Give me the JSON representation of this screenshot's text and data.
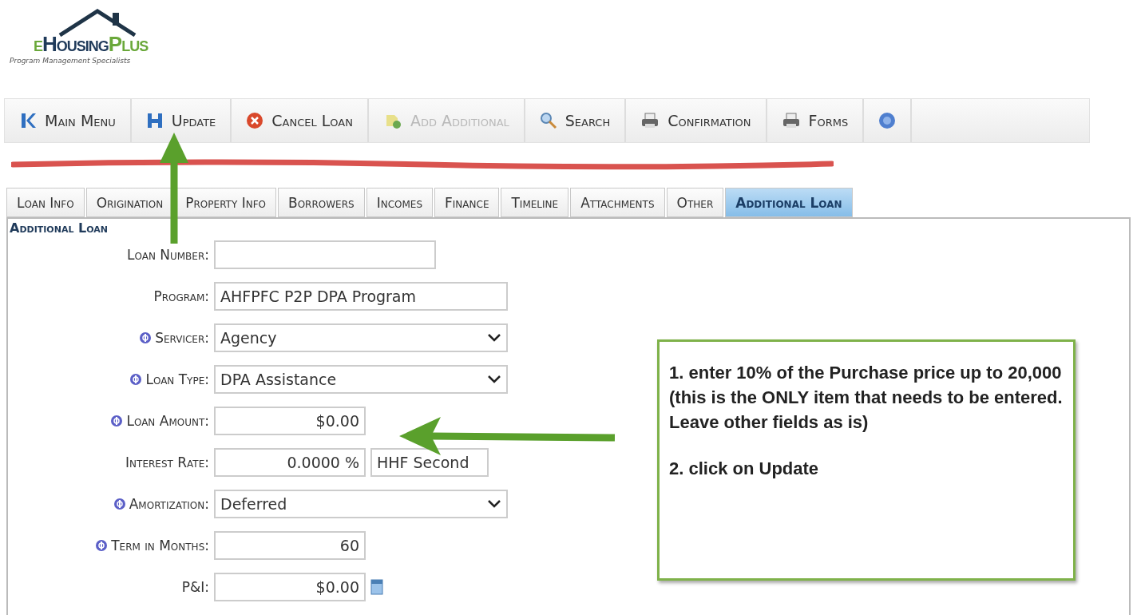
{
  "logo": {
    "prefix": "e",
    "main": "Housing",
    "suffix": "Plus",
    "tagline": "Program Management Specialists"
  },
  "toolbar": [
    {
      "label": "Main Menu",
      "disabled": false
    },
    {
      "label": "Update",
      "disabled": false
    },
    {
      "label": "Cancel Loan",
      "disabled": false
    },
    {
      "label": "Add Additional",
      "disabled": true
    },
    {
      "label": "Search",
      "disabled": false
    },
    {
      "label": "Confirmation",
      "disabled": false
    },
    {
      "label": "Forms",
      "disabled": false
    }
  ],
  "tabs": [
    {
      "label": "Loan Info",
      "selected": false
    },
    {
      "label": "Origination",
      "selected": false
    },
    {
      "label": "Property Info",
      "selected": false
    },
    {
      "label": "Borrowers",
      "selected": false
    },
    {
      "label": "Incomes",
      "selected": false
    },
    {
      "label": "Finance",
      "selected": false
    },
    {
      "label": "Timeline",
      "selected": false
    },
    {
      "label": "Attachments",
      "selected": false
    },
    {
      "label": "Other",
      "selected": false
    },
    {
      "label": "Additional Loan",
      "selected": true
    }
  ],
  "section": {
    "title": "Additional Loan"
  },
  "fields": [
    {
      "label": "Loan Number:",
      "info": false,
      "kind": "entry"
    },
    {
      "label": "Program:",
      "info": false,
      "kind": "text",
      "value": "AHFPFC P2P DPA Program"
    },
    {
      "label": "Servicer:",
      "info": true,
      "kind": "select",
      "value": "Agency"
    },
    {
      "label": "Loan Type:",
      "info": true,
      "kind": "select",
      "value": "DPA Assistance"
    },
    {
      "label": "Loan Amount:",
      "info": true,
      "kind": "amount",
      "value": "$0.00"
    },
    {
      "label": "Interest Rate:",
      "info": false,
      "kind": "rate",
      "value": "0.0000 %",
      "note": "HHF Second"
    },
    {
      "label": "Amortization:",
      "info": true,
      "kind": "select",
      "value": "Deferred"
    },
    {
      "label": "Term in Months:",
      "info": true,
      "kind": "amount",
      "value": "60"
    },
    {
      "label": "P&I:",
      "info": false,
      "kind": "amount",
      "value": "$0.00",
      "calendar": true
    }
  ],
  "callout": {
    "steps": [
      "1. enter 10% of the Purchase price up to 20,000  (this is the ONLY item that needs to be entered.  Leave other fields as is)",
      "2. click on Update"
    ]
  }
}
